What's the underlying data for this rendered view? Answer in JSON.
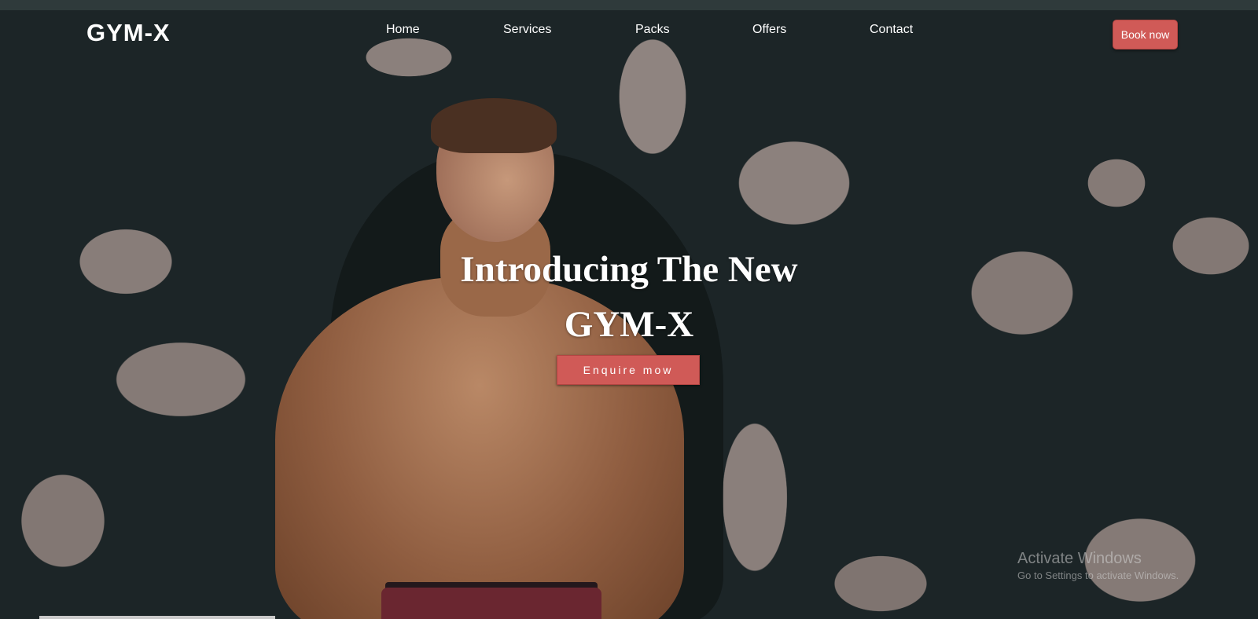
{
  "brand": {
    "logo": "GYM-X"
  },
  "nav": {
    "links": [
      "Home",
      "Services",
      "Packs",
      "Offers",
      "Contact"
    ],
    "book_label": "Book now"
  },
  "hero": {
    "headline_line1": "Introducing The New",
    "headline_line2": "GYM-X",
    "cta_label": "Enquire mow"
  },
  "watermark": {
    "title": "Activate Windows",
    "subtitle": "Go to Settings to activate Windows."
  },
  "colors": {
    "accent": "#d05a57",
    "background": "#1c2527",
    "text": "#ffffff"
  }
}
